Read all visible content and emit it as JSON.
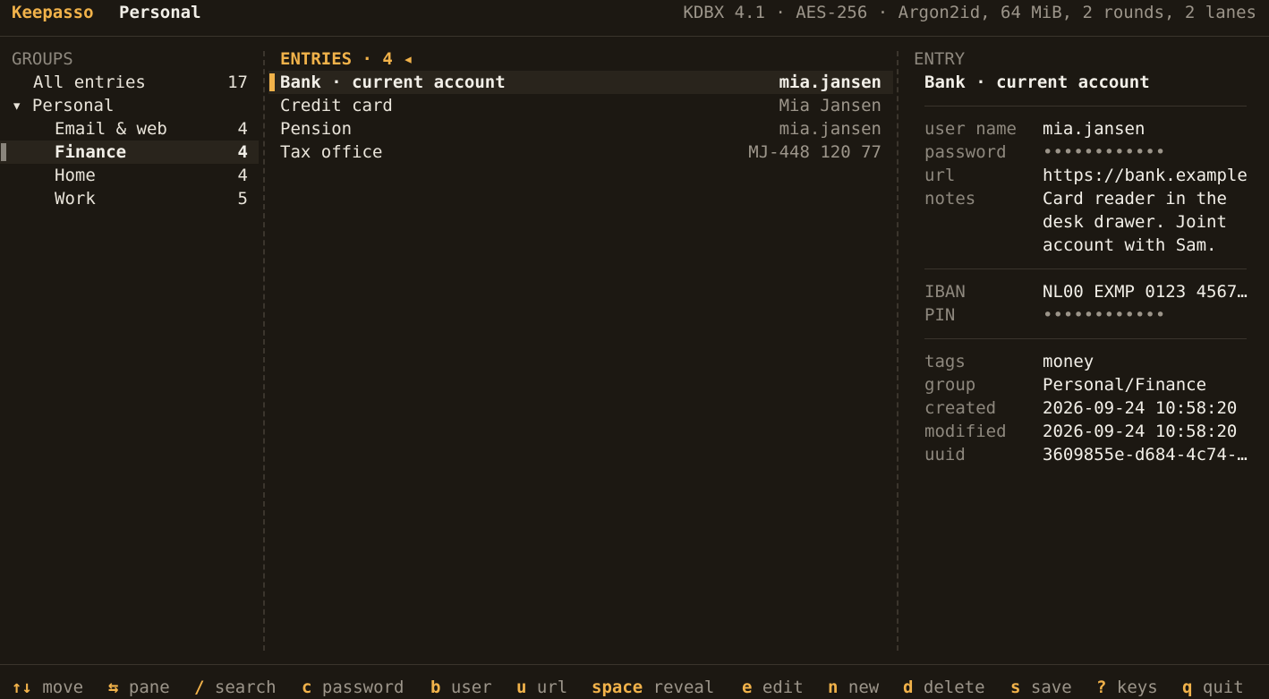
{
  "app": {
    "name": "Keepasso",
    "database": "Personal",
    "db_info": "KDBX 4.1 · AES-256 · Argon2id, 64 MiB, 2 rounds, 2 lanes"
  },
  "groups": {
    "header": "GROUPS",
    "items": [
      {
        "label": "All entries",
        "count": "17"
      },
      {
        "label": "▾ Personal",
        "count": ""
      },
      {
        "label": "Email & web",
        "count": "4"
      },
      {
        "label": "Finance",
        "count": "4"
      },
      {
        "label": "Home",
        "count": "4"
      },
      {
        "label": "Work",
        "count": "5"
      }
    ]
  },
  "entries": {
    "header": "ENTRIES · 4 ◂",
    "items": [
      {
        "title": "Bank · current account",
        "user": "mia.jansen"
      },
      {
        "title": "Credit card",
        "user": "Mia Jansen"
      },
      {
        "title": "Pension",
        "user": "mia.jansen"
      },
      {
        "title": "Tax office",
        "user": "MJ-448 120 77"
      }
    ]
  },
  "entry": {
    "header": "ENTRY",
    "title": "Bank · current account",
    "fields": {
      "user_name": {
        "label": "user name",
        "value": "mia.jansen"
      },
      "password": {
        "label": "password",
        "value": "••••••••••••"
      },
      "url": {
        "label": "url",
        "value": "https://bank.example"
      },
      "notes": {
        "label": "notes",
        "lines": [
          "Card reader in the",
          "desk drawer. Joint",
          "account with Sam."
        ]
      },
      "iban": {
        "label": "IBAN",
        "value": "NL00 EXMP 0123 4567…"
      },
      "pin": {
        "label": "PIN",
        "value": "••••••••••••"
      },
      "tags": {
        "label": "tags",
        "value": "money"
      },
      "group": {
        "label": "group",
        "value": "Personal/Finance"
      },
      "created": {
        "label": "created",
        "value": "2026-09-24 10:58:20"
      },
      "modified": {
        "label": "modified",
        "value": "2026-09-24 10:58:20"
      },
      "uuid": {
        "label": "uuid",
        "value": "3609855e-d684-4c74-…"
      }
    }
  },
  "footer": {
    "keys": [
      {
        "key": "↑↓",
        "action": "move"
      },
      {
        "key": "⇆",
        "action": "pane"
      },
      {
        "key": "/",
        "action": "search"
      },
      {
        "key": "c",
        "action": "password"
      },
      {
        "key": "b",
        "action": "user"
      },
      {
        "key": "u",
        "action": "url"
      },
      {
        "key": "space",
        "action": "reveal"
      },
      {
        "key": "e",
        "action": "edit"
      },
      {
        "key": "n",
        "action": "new"
      },
      {
        "key": "d",
        "action": "delete"
      },
      {
        "key": "s",
        "action": "save"
      },
      {
        "key": "?",
        "action": "keys"
      },
      {
        "key": "q",
        "action": "quit"
      }
    ]
  },
  "colors": {
    "background": "#1c1812",
    "accent": "#f1b24a",
    "text": "#e9e4da",
    "dim": "#9c958a",
    "selected_row": "#29241c"
  }
}
